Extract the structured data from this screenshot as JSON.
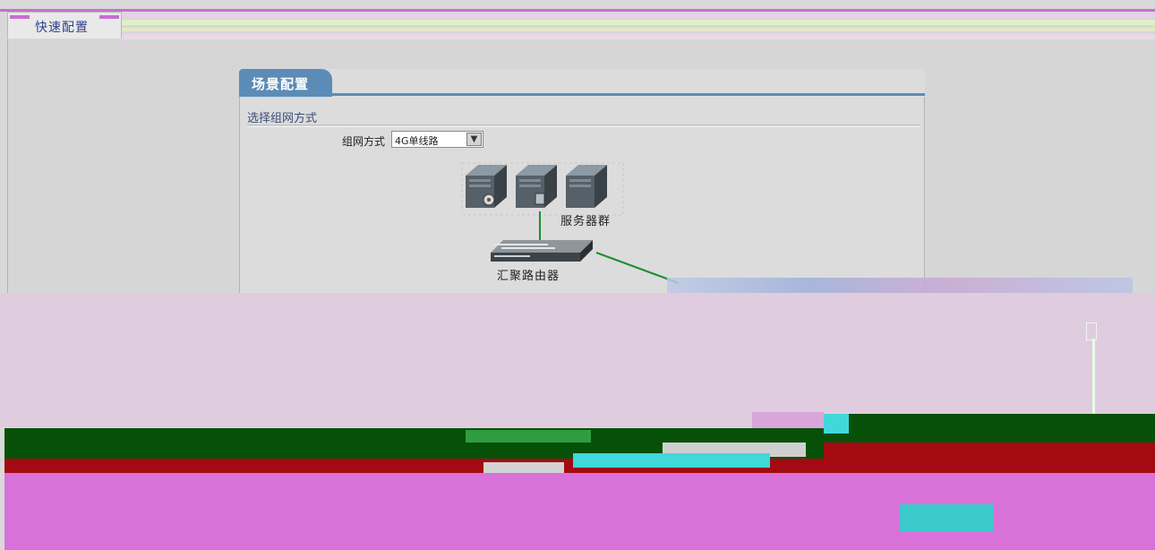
{
  "tabs": {
    "quick_config": "快速配置"
  },
  "panel": {
    "title": "场景配置",
    "section_title": "选择组网方式",
    "mode_label": "组网方式",
    "mode_value": "4G单线路"
  },
  "diagram": {
    "server_group_label": "服务器群",
    "router_label": "汇聚路由器"
  },
  "colors": {
    "panel_tab": "#5b8cb7",
    "link_green": "#1a8f2e",
    "tab_text": "#2f3f8f"
  },
  "icons": {
    "select_arrow": "chevron-down-icon",
    "server": "server-icon",
    "router": "router-icon"
  }
}
